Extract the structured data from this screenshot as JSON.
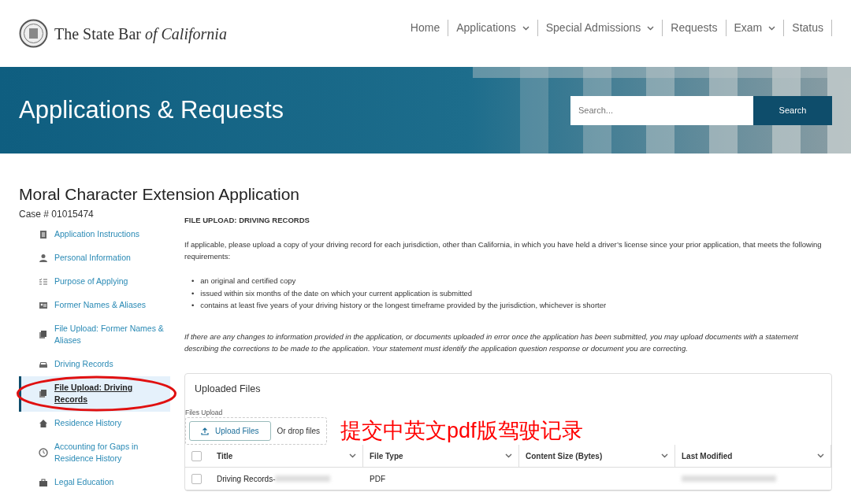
{
  "header": {
    "logo_text": "The State Bar ",
    "logo_italic": "of California",
    "nav": [
      {
        "label": "Home",
        "dropdown": false
      },
      {
        "label": "Applications",
        "dropdown": true
      },
      {
        "label": "Special Admissions",
        "dropdown": true
      },
      {
        "label": "Requests",
        "dropdown": false
      },
      {
        "label": "Exam",
        "dropdown": true
      },
      {
        "label": "Status",
        "dropdown": false
      }
    ]
  },
  "banner": {
    "title": "Applications & Requests",
    "search": {
      "placeholder": "Search...",
      "button": "Search"
    }
  },
  "page": {
    "title": "Moral Character Extension Application",
    "case": "Case # 01015474"
  },
  "sidebar": {
    "items": [
      {
        "label": "Application Instructions",
        "kind": "list",
        "selected": false
      },
      {
        "label": "Personal Information",
        "kind": "person",
        "selected": false
      },
      {
        "label": "Purpose of Applying",
        "kind": "checklist",
        "selected": false
      },
      {
        "label": "Former Names & Aliases",
        "kind": "idcard",
        "selected": false
      },
      {
        "label": "File Upload: Former Names & Aliases",
        "kind": "files",
        "selected": false
      },
      {
        "label": "Driving Records",
        "kind": "car",
        "selected": false
      },
      {
        "label": "File Upload: Driving Records",
        "kind": "files",
        "selected": true
      },
      {
        "label": "Residence History",
        "kind": "home",
        "selected": false
      },
      {
        "label": "Accounting for Gaps in Residence History",
        "kind": "clock",
        "selected": false
      },
      {
        "label": "Legal Education",
        "kind": "briefcase",
        "selected": false
      }
    ]
  },
  "content": {
    "heading": "FILE UPLOAD: DRIVING RECORDS",
    "intro": "If applicable, please upload a copy of your driving record for each jurisdiction, other than California, in which you have held a driver’s license since your prior application, that meets the following requirements:",
    "bullet": "•",
    "requirements": [
      "an original and certified copy",
      "issued within six months of the date on which your current application is submitted",
      "contains at least five years of your driving history or the longest timeframe provided by the jurisdiction, whichever is shorter"
    ],
    "note": "If there are any changes to information provided in the application, or documents uploaded in error once the application has been submitted, you may upload documents with a statement describing the corrections to be made to the application. Your statement must identify the application question response or document you are correcting."
  },
  "uploaded_files": {
    "title": "Uploaded Files",
    "upload_label": "Files Upload",
    "upload_button": "Upload Files",
    "select_all_checked": false,
    "drop_text": "Or drop files",
    "columns": [
      "Title",
      "File Type",
      "Content Size (Bytes)",
      "Last Modified"
    ],
    "rows": [
      {
        "title": "Driving Records-",
        "file_type": "PDF",
        "checked": false
      }
    ]
  },
  "annotation": {
    "text": "提交中英文pdf版驾驶记录"
  }
}
